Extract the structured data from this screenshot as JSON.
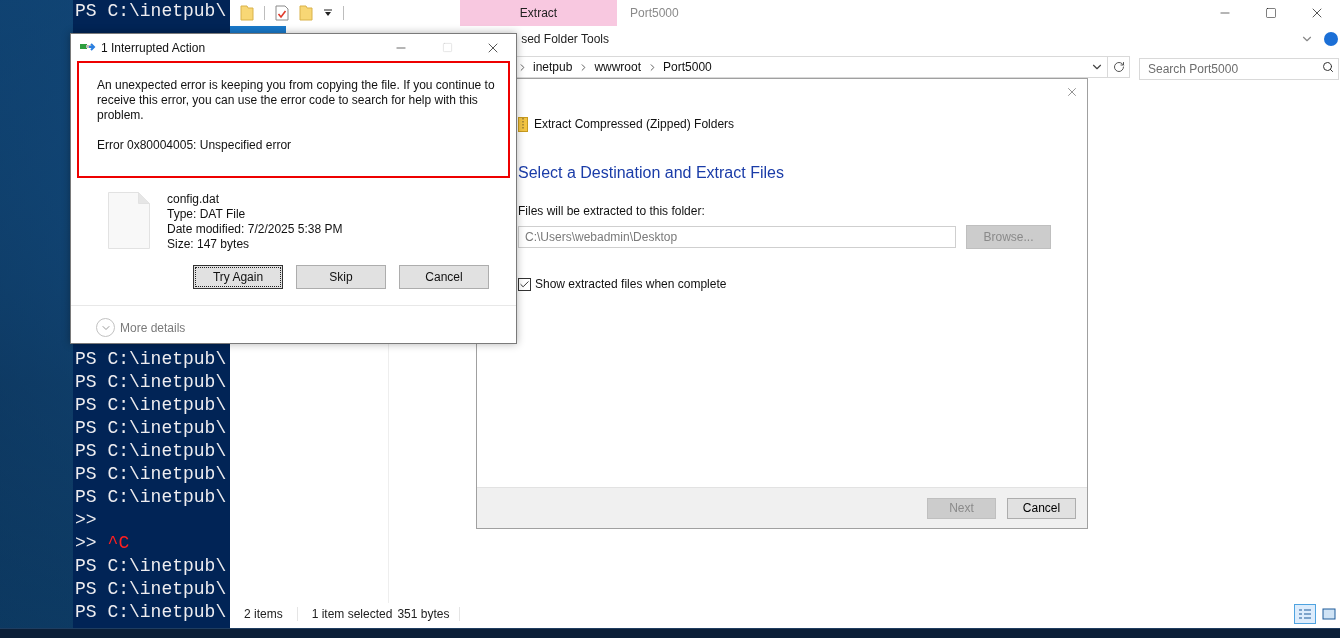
{
  "console": {
    "lines_above_dialog": [
      {
        "prompt": "PS C:\\inetpub\\"
      }
    ],
    "lines_below_dialog": [
      {
        "prompt": "PS C:\\inetpub\\"
      },
      {
        "prompt": "PS C:\\inetpub\\"
      },
      {
        "prompt": "PS C:\\inetpub\\"
      },
      {
        "prompt": "PS C:\\inetpub\\"
      },
      {
        "prompt": "PS C:\\inetpub\\"
      },
      {
        "prompt": "PS C:\\inetpub\\"
      },
      {
        "prompt": "PS C:\\inetpub\\"
      },
      {
        "prompt": ">>"
      },
      {
        "prompt": ">>",
        "interrupt": "^C"
      },
      {
        "prompt": "PS C:\\inetpub\\"
      },
      {
        "prompt": "PS C:\\inetpub\\"
      },
      {
        "prompt": "PS C:\\inetpub\\"
      }
    ]
  },
  "explorer": {
    "title": "Port5000",
    "context_tab": "Extract",
    "context_group": "sed Folder Tools",
    "address": {
      "crumbs": [
        "inetpub",
        "wwwroot",
        "Port5000"
      ]
    },
    "search": {
      "placeholder": "Search Port5000"
    },
    "status_bar": {
      "items": "2 items",
      "selection": "1 item selected",
      "size": "351 bytes"
    },
    "view_buttons": [
      {
        "kind": "details",
        "selected": true
      },
      {
        "kind": "large-icons",
        "selected": false
      }
    ]
  },
  "wizard": {
    "header": "Extract Compressed (Zipped) Folders",
    "heading": "Select a Destination and Extract Files",
    "field_label": "Files will be extracted to this folder:",
    "folder": {
      "value": "C:\\Users\\webadmin\\Desktop",
      "disabled": true
    },
    "browse": {
      "label": "Browse...",
      "disabled": true
    },
    "show_files": {
      "label": "Show extracted files when complete",
      "checked": true
    },
    "buttons": [
      {
        "label": "Next",
        "disabled": true
      },
      {
        "label": "Cancel",
        "disabled": false
      }
    ]
  },
  "error_dialog": {
    "title": "1 Interrupted Action",
    "message": "An unexpected error is keeping you from copying the file. If you continue to receive this error, you can use the error code to search for help with this problem.",
    "error": "Error 0x80004005: Unspecified error",
    "file": {
      "name": "config.dat",
      "details": [
        "Type: DAT File",
        "Date modified: 7/2/2025 5:38 PM",
        "Size: 147 bytes"
      ]
    },
    "buttons": [
      {
        "label": "Try Again",
        "focused": true
      },
      {
        "label": "Skip",
        "focused": false
      },
      {
        "label": "Cancel",
        "focused": false
      }
    ],
    "more_details": "More details"
  }
}
